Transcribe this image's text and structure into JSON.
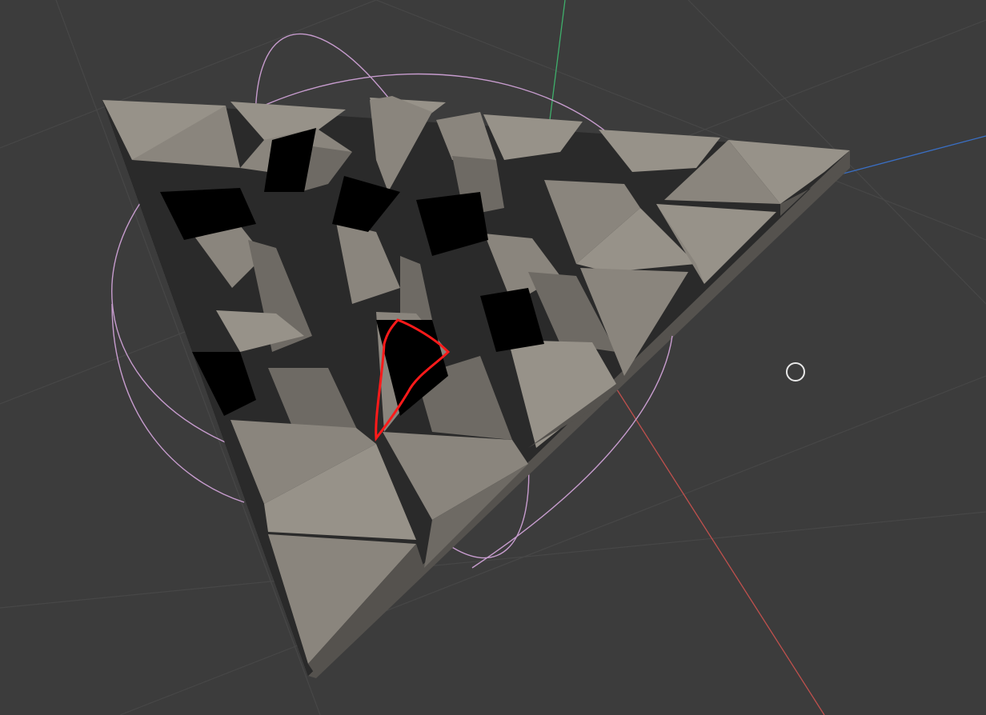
{
  "viewport": {
    "background": "#3c3c3c",
    "grid_color": "#474747",
    "axis_colors": {
      "x": "#c0504d",
      "y": "#3fae6b",
      "z": "#3a6fc4"
    }
  },
  "mesh": {
    "face_light": "#979289",
    "face_mid": "#8a857d",
    "face_dark": "#6e6a64",
    "side": "#55524e",
    "void": "#000000"
  },
  "gizmo": {
    "color": "#c79cce",
    "cursor_color": "#e8e8e8",
    "cursor_icon": "3d-cursor-icon"
  },
  "annotation": {
    "color": "#ff1a1a",
    "icon": "red-freehand-outline"
  }
}
